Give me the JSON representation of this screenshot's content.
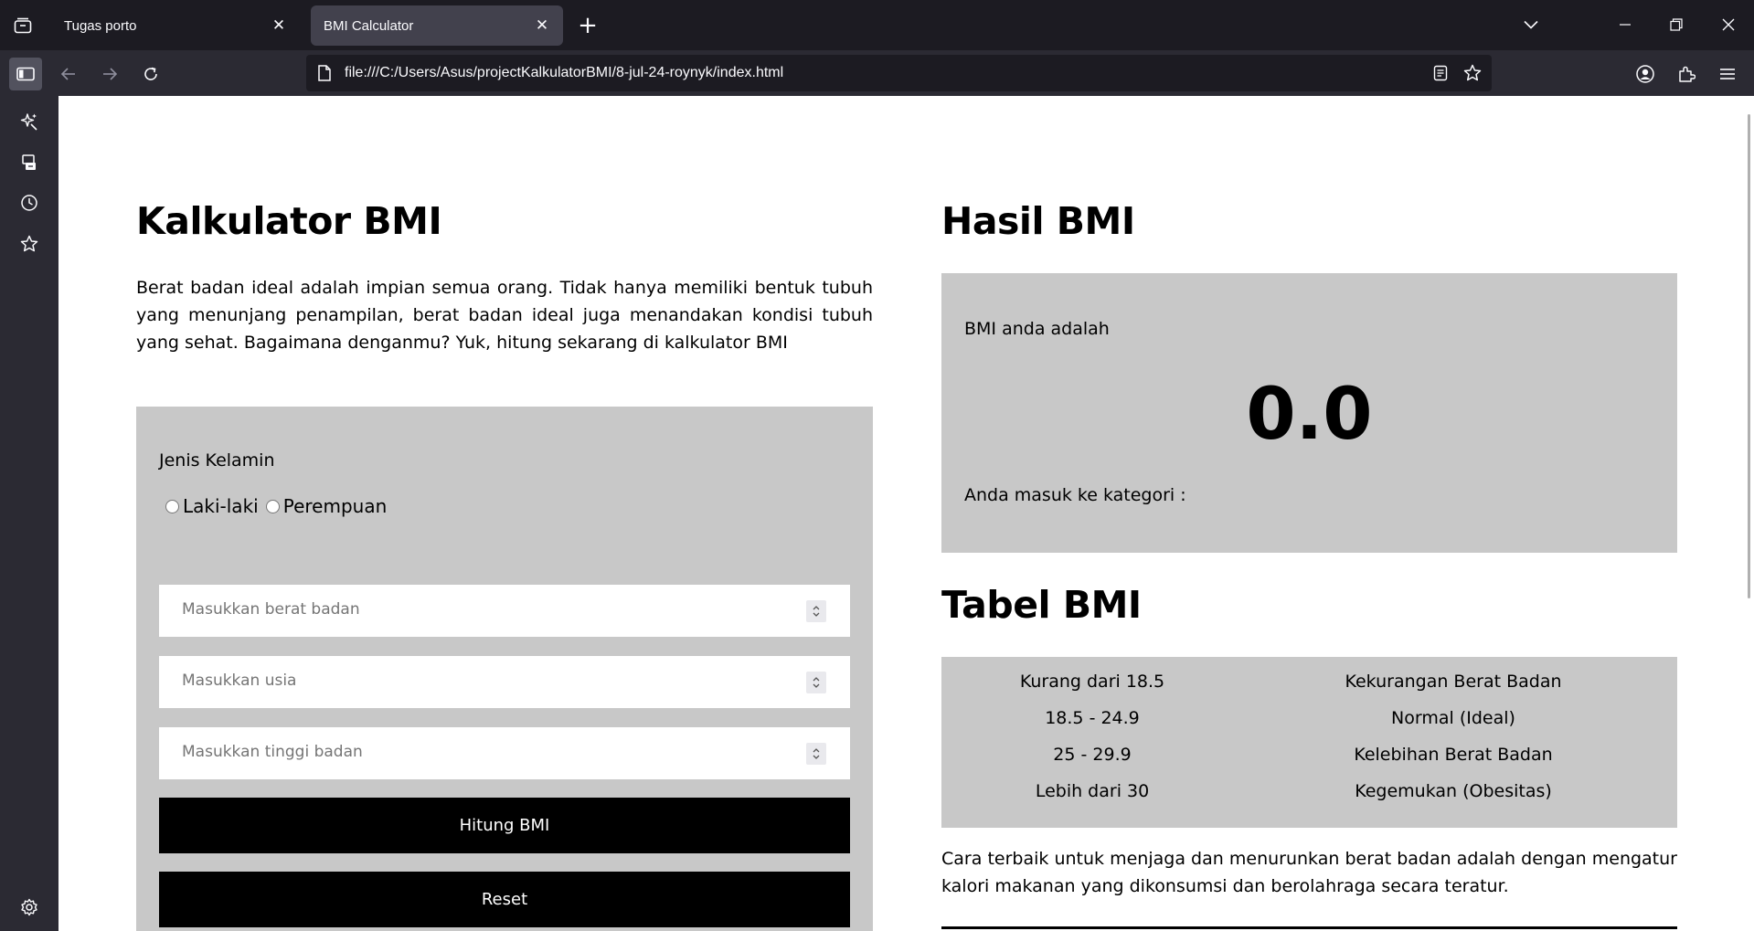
{
  "browser": {
    "tabs": [
      {
        "title": "Tugas porto",
        "active": false
      },
      {
        "title": "BMI Calculator",
        "active": true
      }
    ],
    "url": "file:///C:/Users/Asus/projectKalkulatorBMI/8-jul-24-roynyk/index.html"
  },
  "calculator": {
    "title": "Kalkulator BMI",
    "intro": "Berat badan ideal adalah impian semua orang. Tidak hanya memiliki bentuk tubuh yang menunjang penampilan, berat badan ideal juga menandakan kondisi tubuh yang sehat. Bagaimana denganmu? Yuk, hitung sekarang di kalkulator BMI",
    "gender_label": "Jenis Kelamin",
    "gender_options": [
      "Laki-laki",
      "Perempuan"
    ],
    "weight_placeholder": "Masukkan berat badan",
    "age_placeholder": "Masukkan usia",
    "height_placeholder": "Masukkan tinggi badan",
    "calculate_label": "Hitung BMI",
    "reset_label": "Reset"
  },
  "result": {
    "title": "Hasil BMI",
    "label": "BMI anda adalah",
    "value": "0.0",
    "category_label": "Anda masuk ke kategori :"
  },
  "bmi_table": {
    "title": "Tabel BMI",
    "rows": [
      {
        "range": "Kurang dari 18.5",
        "category": "Kekurangan Berat Badan"
      },
      {
        "range": "18.5 - 24.9",
        "category": "Normal (Ideal)"
      },
      {
        "range": "25 - 29.9",
        "category": "Kelebihan Berat Badan"
      },
      {
        "range": "Lebih dari 30",
        "category": "Kegemukan (Obesitas)"
      }
    ],
    "footer": "Cara terbaik untuk menjaga dan menurunkan berat badan adalah dengan mengatur kalori makanan yang dikonsumsi dan berolahraga secara teratur."
  }
}
